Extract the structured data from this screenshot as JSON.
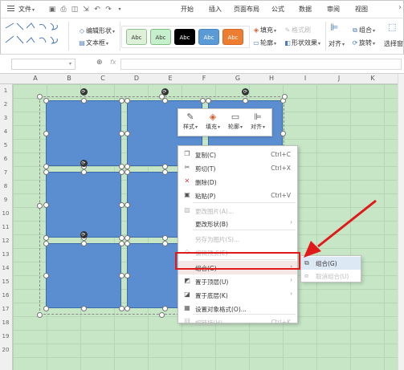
{
  "menubar": {
    "file_label": "文件",
    "file_caret": "▾",
    "tabs": [
      "开始",
      "插入",
      "页面布局",
      "公式",
      "数据",
      "审阅",
      "视图"
    ]
  },
  "toolbar": {
    "edit_shape": "编辑形状",
    "text_box": "文本框",
    "style_label": "Abc",
    "styles": [
      {
        "bg": "#dff0d8",
        "fg": "#333333",
        "border": "#8fc48f"
      },
      {
        "bg": "#c6efce",
        "fg": "#333333",
        "border": "#7fbf7f"
      },
      {
        "bg": "#000000",
        "fg": "#ffffff",
        "border": "#000000"
      },
      {
        "bg": "#5b9bd5",
        "fg": "#ffffff",
        "border": "#4a86c0"
      },
      {
        "bg": "#ed7d31",
        "fg": "#ffffff",
        "border": "#d4692a"
      }
    ],
    "fill": "填充",
    "outline": "轮廓",
    "format_brush": "格式刷",
    "shape_effects": "形状效果",
    "align": "对齐",
    "group": "组合",
    "rotate": "旋转",
    "select_pane": "选择窗"
  },
  "formula_bar": {
    "zoom_icon": "zoom-icon",
    "fx": "fx"
  },
  "sheet": {
    "columns": [
      "A",
      "B",
      "C",
      "D",
      "E",
      "F",
      "G",
      "H",
      "I",
      "J",
      "K"
    ],
    "rows": [
      "1",
      "2",
      "3",
      "4",
      "5",
      "6",
      "7",
      "8",
      "9",
      "10",
      "11",
      "12",
      "13",
      "14",
      "15",
      "16",
      "17",
      "18",
      "19",
      "20"
    ]
  },
  "float_toolbar": {
    "items": [
      {
        "label": "样式",
        "icon": "pen-icon"
      },
      {
        "label": "填充",
        "icon": "fill-bucket-icon"
      },
      {
        "label": "轮廓",
        "icon": "outline-icon"
      },
      {
        "label": "对齐",
        "icon": "align-icon"
      }
    ]
  },
  "context_menu": {
    "items": [
      {
        "label": "复制(C)",
        "shortcut": "Ctrl+C",
        "icon": "copy-icon",
        "disabled": false
      },
      {
        "label": "剪切(T)",
        "shortcut": "Ctrl+X",
        "icon": "cut-icon",
        "disabled": false
      },
      {
        "label": "删除(D)",
        "shortcut": "",
        "icon": "delete-icon",
        "disabled": false
      },
      {
        "label": "粘贴(P)",
        "shortcut": "Ctrl+V",
        "icon": "paste-icon",
        "disabled": false
      },
      {
        "label": "更改图片(A)...",
        "shortcut": "",
        "icon": "picture-icon",
        "disabled": true
      },
      {
        "label": "更改形状(B)",
        "shortcut": "",
        "icon": "",
        "disabled": false,
        "submenu": true
      },
      {
        "label": "另存为图片(S)...",
        "shortcut": "",
        "icon": "",
        "disabled": true
      },
      {
        "label": "编辑顶点(E)",
        "shortcut": "",
        "icon": "edit-points-icon",
        "disabled": true
      },
      {
        "label": "组合(G)",
        "shortcut": "",
        "icon": "",
        "disabled": false,
        "submenu": true,
        "highlight": true
      },
      {
        "label": "置于顶层(U)",
        "shortcut": "",
        "icon": "bring-front-icon",
        "disabled": false,
        "submenu": true
      },
      {
        "label": "置于底层(K)",
        "shortcut": "",
        "icon": "send-back-icon",
        "disabled": false,
        "submenu": true
      },
      {
        "label": "设置对象格式(O)...",
        "shortcut": "",
        "icon": "format-object-icon",
        "disabled": false
      },
      {
        "label": "超链接(H)...",
        "shortcut": "Ctrl+K",
        "icon": "hyperlink-icon",
        "disabled": true
      }
    ]
  },
  "submenu": {
    "items": [
      {
        "label": "组合(G)",
        "icon": "group-icon",
        "active": true
      },
      {
        "label": "取消组合(U)",
        "icon": "ungroup-icon",
        "active": false,
        "disabled": true
      }
    ]
  },
  "colors": {
    "shape_fill": "#5b8ed1",
    "sheet_bg": "#c6e6c6",
    "annotation_red": "#e0191b"
  }
}
